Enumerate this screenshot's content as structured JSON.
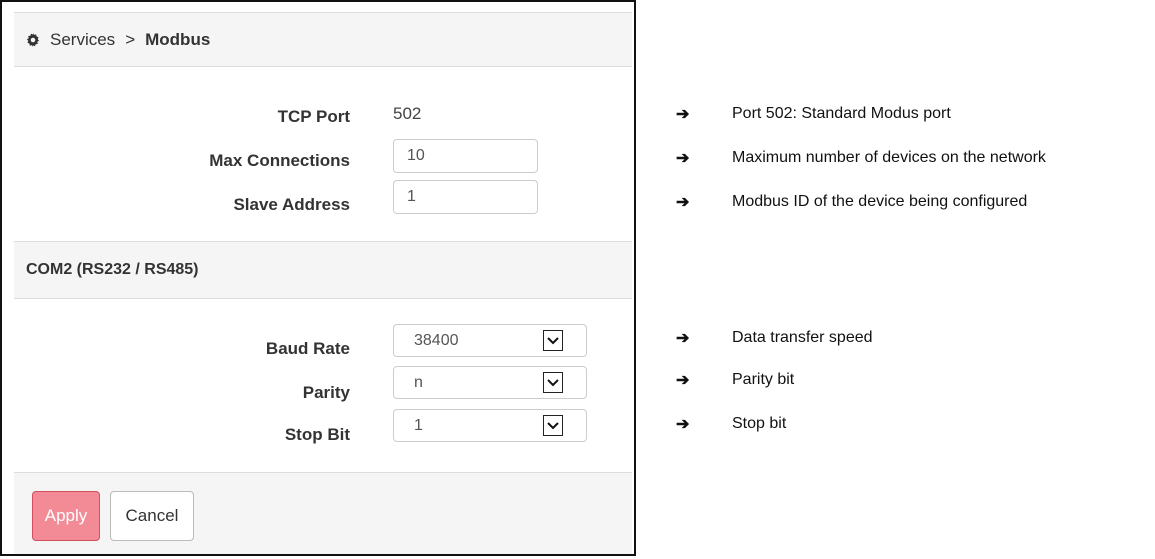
{
  "breadcrumb": {
    "section": "Services",
    "separator": ">",
    "current": "Modbus"
  },
  "tcp": {
    "port_label": "TCP Port",
    "port_value": "502",
    "max_connections_label": "Max Connections",
    "max_connections_value": "10",
    "slave_address_label": "Slave Address",
    "slave_address_value": "1"
  },
  "com2": {
    "title": "COM2 (RS232 / RS485)",
    "baud_rate_label": "Baud Rate",
    "baud_rate_value": "38400",
    "parity_label": "Parity",
    "parity_value": "n",
    "stop_bit_label": "Stop Bit",
    "stop_bit_value": "1"
  },
  "buttons": {
    "apply": "Apply",
    "cancel": "Cancel"
  },
  "annotations": [
    {
      "arrow": "➔",
      "text": "Port 502: Standard Modus port"
    },
    {
      "arrow": "➔",
      "text": "Maximum number of devices on the network"
    },
    {
      "arrow": "➔",
      "text": "Modbus ID of the device being configured"
    },
    {
      "arrow": "➔",
      "text": "Data transfer speed"
    },
    {
      "arrow": "➔",
      "text": "Parity bit"
    },
    {
      "arrow": "➔",
      "text": "Stop bit"
    }
  ],
  "colors": {
    "apply_button": "#f28b96",
    "header_bg": "#f5f5f5"
  },
  "icons": {
    "breadcrumb": "gear-icon",
    "select": "chevron-down-icon"
  }
}
